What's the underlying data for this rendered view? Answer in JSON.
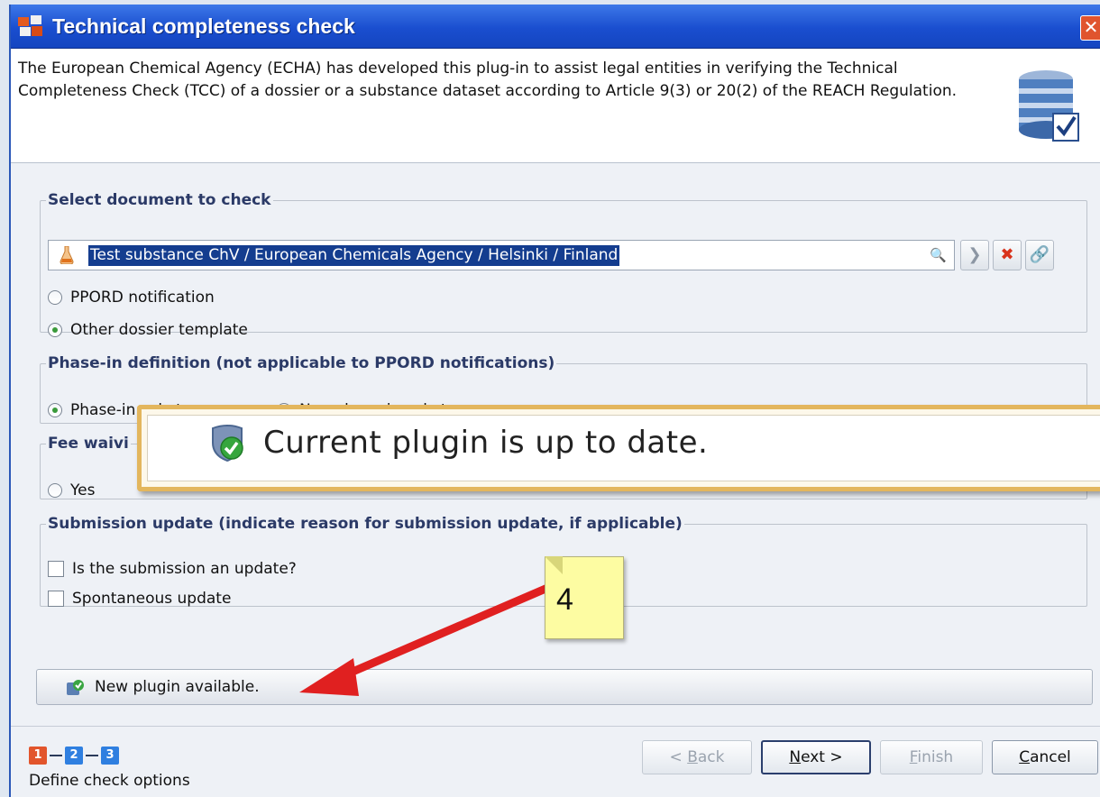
{
  "window": {
    "title": "Technical completeness check",
    "close_glyph": "✕"
  },
  "header": {
    "description": "The European Chemical Agency (ECHA) has developed this plug-in to assist legal entities in verifying the Technical Completeness Check (TCC) of a dossier or a substance dataset according to Article 9(3) or 20(2) of the REACH Regulation."
  },
  "select_document": {
    "legend": "Select document to check",
    "selected_value": "Test substance ChV / European Chemicals Agency / Helsinki / Finland",
    "options": [
      {
        "label": "PPORD notification",
        "selected": false
      },
      {
        "label": "Other dossier template",
        "selected": true
      }
    ]
  },
  "phase_in": {
    "legend": "Phase-in definition (not applicable to PPORD notifications)",
    "options": [
      {
        "label": "Phase-in substance",
        "selected": true
      },
      {
        "label": "Non phase-in substance",
        "selected": false
      }
    ]
  },
  "fee_waiving": {
    "legend_visible": "Fee waivi",
    "options": [
      {
        "label": "Yes",
        "selected": false
      }
    ]
  },
  "submission_update": {
    "legend": "Submission update (indicate reason for submission update, if applicable)",
    "checkboxes": [
      {
        "label": "Is the submission an update?",
        "checked": false
      },
      {
        "label": "Spontaneous update",
        "checked": false
      }
    ]
  },
  "notification": {
    "message": "Current plugin is up to date."
  },
  "plugin_bar": {
    "label": "New plugin available."
  },
  "annotation": {
    "number": "4",
    "arrow_color": "#e02020"
  },
  "footer": {
    "steps": [
      "1",
      "2",
      "3"
    ],
    "step_label": "Define check options",
    "buttons": {
      "back": {
        "prefix": "< ",
        "mnemonic": "B",
        "rest": "ack"
      },
      "next": {
        "mnemonic": "N",
        "rest": "ext >"
      },
      "finish": {
        "mnemonic": "F",
        "rest": "inish"
      },
      "cancel": {
        "mnemonic": "C",
        "rest": "ancel"
      }
    }
  },
  "colors": {
    "titlebar": "#1a4ecf",
    "legend_text": "#2b3a67",
    "selection": "#143d8f",
    "notify_border": "#e3b65d",
    "sticky_note": "#fdfca2"
  }
}
